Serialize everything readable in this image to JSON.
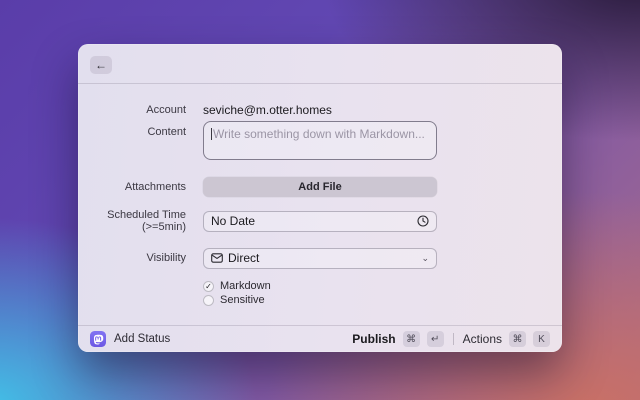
{
  "window": {
    "titlebar": {
      "back_icon": "←"
    },
    "form": {
      "account": {
        "label": "Account",
        "value": "seviche@m.otter.homes"
      },
      "content": {
        "label": "Content",
        "placeholder": "Write something down with Markdown..."
      },
      "attachments": {
        "label": "Attachments",
        "button_label": "Add File"
      },
      "scheduled_time": {
        "label": "Scheduled Time (>=5min)",
        "value": "No Date"
      },
      "visibility": {
        "label": "Visibility",
        "value": "Direct",
        "chevron": "⌄"
      },
      "markdown_checkbox": {
        "label": "Markdown",
        "checked": true,
        "check_glyph": "✓"
      },
      "sensitive_checkbox": {
        "label": "Sensitive",
        "checked": false,
        "check_glyph": ""
      }
    },
    "footer": {
      "app_label": "Add Status",
      "publish": {
        "label": "Publish",
        "keys": [
          "⌘",
          "↵"
        ]
      },
      "actions": {
        "label": "Actions",
        "keys": [
          "⌘",
          "K"
        ]
      }
    }
  },
  "colors": {
    "accent_purple": "#6c58e4",
    "bg_top_left": "#5a3da9",
    "bg_top_right": "#281a3a",
    "bg_bottom_left": "#41c2e8",
    "bg_bottom_right": "#c97066",
    "window_tint": "#e9e2ef"
  }
}
